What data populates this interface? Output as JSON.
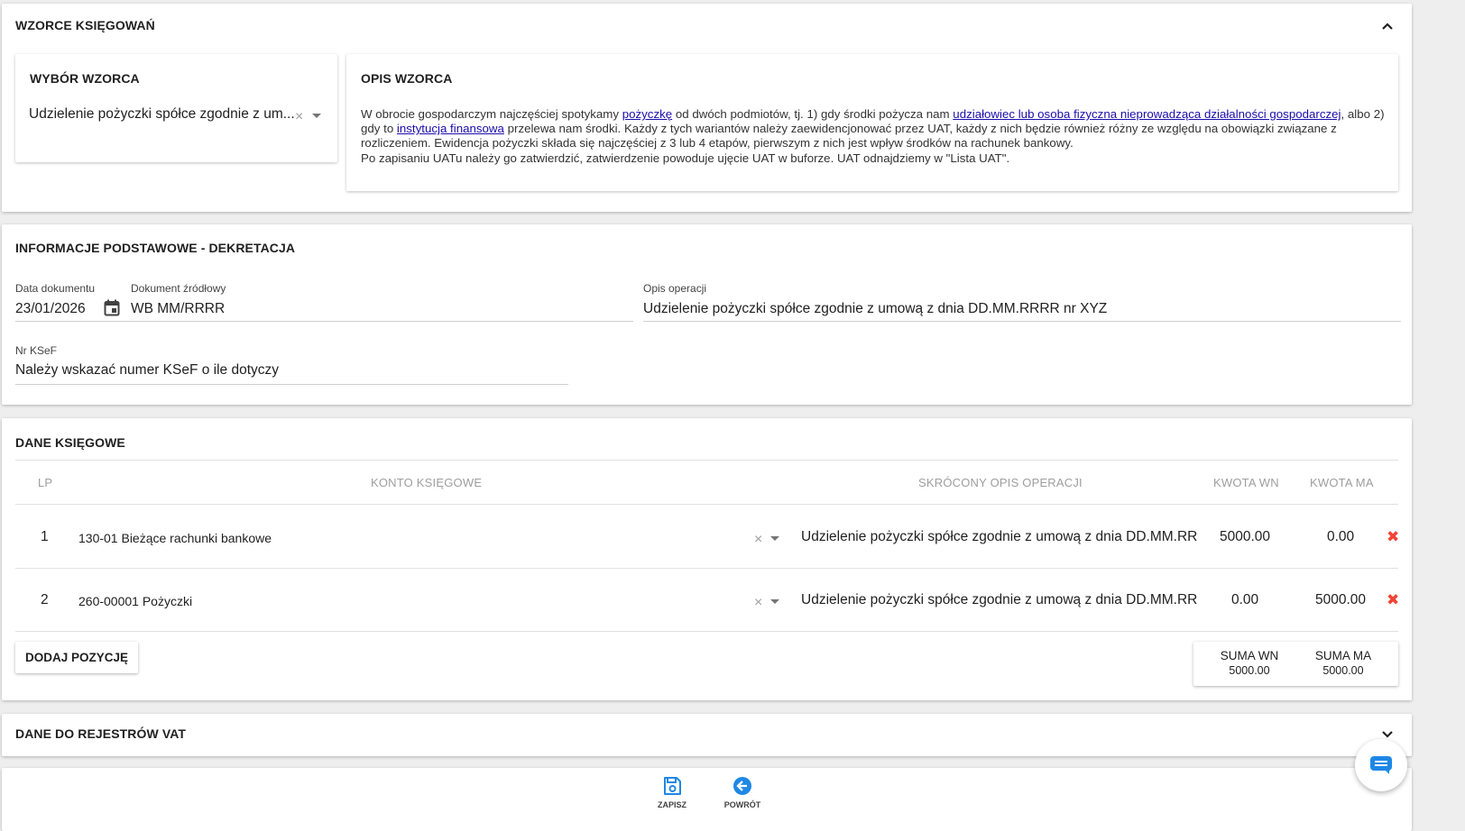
{
  "colors": {
    "accent": "#1e88e5",
    "danger": "#f44336"
  },
  "templates_section": {
    "title": "WZORCE KSIĘGOWAŃ",
    "picker": {
      "title": "WYBÓR WZORCA",
      "selected": "Udzielenie pożyczki spółce zgodnie z um...",
      "clear_icon": "close-icon",
      "dropdown_icon": "caret-down-icon"
    },
    "description": {
      "title": "OPIS WZORCA",
      "p1_a": "W obrocie gospodarczym najczęściej spotykamy ",
      "link1": "pożyczkę",
      "p1_b": " od dwóch podmiotów, tj. 1) gdy środki pożycza nam ",
      "link2": "udziałowiec lub osoba fizyczna nieprowadząca działalności gospodarczej",
      "p1_c": ", albo 2) gdy to ",
      "link3": "instytucja finansowa",
      "p1_d": " przelewa nam środki. Każdy z tych wariantów należy zaewidencjonować przez UAT, każdy z nich będzie również różny ze względu na obowiązki związane z rozliczeniem. Ewidencja pożyczki składa się najczęściej z 3 lub 4 etapów, pierwszym z nich jest wpływ środków na rachunek bankowy.",
      "p2": "Po zapisaniu UATu należy go zatwierdzić, zatwierdzenie powoduje ujęcie UAT w buforze. UAT odnajdziemy w \"Lista UAT\"."
    }
  },
  "basic_info": {
    "title": "INFORMACJE PODSTAWOWE - DEKRETACJA",
    "doc_date": {
      "label": "Data dokumentu",
      "value": "23/01/2026"
    },
    "source_doc": {
      "label": "Dokument źródłowy",
      "value": "WB MM/RRRR"
    },
    "operation_desc": {
      "label": "Opis operacji",
      "value": "Udzielenie pożyczki spółce zgodnie z umową z dnia DD.MM.RRRR nr XYZ"
    },
    "ksef": {
      "label": "Nr KSeF",
      "placeholder": "Należy wskazać numer KSeF o ile dotyczy"
    }
  },
  "accounting": {
    "title": "DANE KSIĘGOWE",
    "columns": {
      "lp": "LP",
      "account": "KONTO KSIĘGOWE",
      "desc": "SKRÓCONY OPIS OPERACJI",
      "wn": "KWOTA WN",
      "ma": "KWOTA MA"
    },
    "rows": [
      {
        "lp": "1",
        "account": "130-01 Bieżące rachunki bankowe",
        "desc": "Udzielenie pożyczki spółce zgodnie z umową z dnia DD.MM.RR",
        "wn": "5000.00",
        "ma": "0.00"
      },
      {
        "lp": "2",
        "account": "260-00001 Pożyczki",
        "desc": "Udzielenie pożyczki spółce zgodnie z umową z dnia DD.MM.RR",
        "wn": "0.00",
        "ma": "5000.00"
      }
    ],
    "add_button": "DODAJ POZYCJĘ",
    "sum_wn_label": "SUMA WN",
    "sum_wn_value": "5000.00",
    "sum_ma_label": "SUMA MA",
    "sum_ma_value": "5000.00"
  },
  "vat_section": {
    "title": "DANE DO REJESTRÓW VAT"
  },
  "footer": {
    "save_label": "ZAPISZ",
    "back_label": "POWRÓT"
  }
}
